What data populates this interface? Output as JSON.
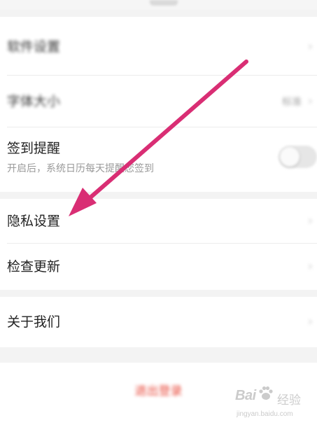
{
  "header": {
    "title": ""
  },
  "settings": {
    "row1": {
      "label": "软件设置"
    },
    "row2": {
      "label": "字体大小",
      "value": "标准"
    },
    "sign_in_reminder": {
      "label": "签到提醒",
      "description": "开启后，系统日历每天提醒您签到"
    },
    "privacy": {
      "label": "隐私设置"
    },
    "check_update": {
      "label": "检查更新"
    },
    "about_us": {
      "label": "关于我们"
    }
  },
  "logout": {
    "label": "退出登录"
  },
  "icons": {
    "chevron": "›"
  },
  "colors": {
    "annotation_arrow": "#d92e74",
    "logout_text": "#e8483a",
    "background": "#f3f3f3"
  },
  "watermark": {
    "logo_text": "Bai",
    "cn_text": "经验",
    "url": "jingyan.baidu.com"
  }
}
